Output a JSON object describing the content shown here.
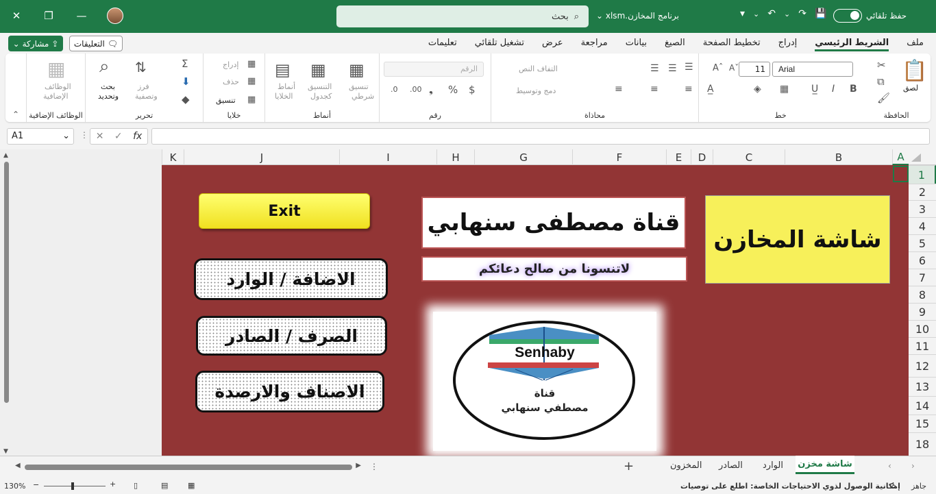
{
  "titlebar": {
    "search_placeholder": "بحث",
    "filename": "برنامج المخازن.xlsm",
    "autosave_label": "حفظ تلقائي"
  },
  "menu": {
    "share_label": "مشاركة",
    "comments_label": "التعليقات",
    "tabs": [
      "ملف",
      "الشريط الرئيسي",
      "إدراج",
      "تخطيط الصفحة",
      "الصيغ",
      "بيانات",
      "مراجعة",
      "عرض",
      "تشغيل تلقائي",
      "تعليمات"
    ]
  },
  "ribbon": {
    "clipboard": {
      "label": "الحافظة",
      "paste": "لصق"
    },
    "font": {
      "label": "خط",
      "name": "Arial",
      "size": "11"
    },
    "alignment": {
      "label": "محاذاة",
      "wrap": "التفاف النص",
      "merge": "دمج وتوسيط"
    },
    "number": {
      "label": "رقم",
      "format": "الرقم"
    },
    "styles": {
      "label": "أنماط",
      "conditional_1": "تنسيق",
      "conditional_2": "شرطي",
      "table_1": "التنسيق",
      "table_2": "كجدول",
      "cell_1": "أنماط",
      "cell_2": "الخلايا"
    },
    "cells": {
      "label": "خلايا",
      "insert": "إدراج",
      "delete": "حذف",
      "format": "تنسيق"
    },
    "editing": {
      "label": "تحرير",
      "sort_1": "فرز",
      "sort_2": "وتصفية",
      "find_1": "بحث",
      "find_2": "وتحديد"
    },
    "addins": {
      "label": "الوظائف الإضافية",
      "btn_1": "الوظائف",
      "btn_2": "الإضافية"
    }
  },
  "formula_bar": {
    "name_box": "A1",
    "fx": "fx",
    "formula": ""
  },
  "columns": [
    "K",
    "J",
    "I",
    "H",
    "G",
    "F",
    "E",
    "D",
    "C",
    "B",
    "A"
  ],
  "rows": [
    "1",
    "2",
    "3",
    "4",
    "5",
    "6",
    "7",
    "8",
    "9",
    "10",
    "11",
    "12",
    "13",
    "14",
    "15",
    "18"
  ],
  "sheet_content": {
    "title": "شاشة المخازن",
    "channel": "قناة مصطفى سنهابي",
    "prayer": "لاتنسونا من صالح دعائكم",
    "exit_label": "Exit",
    "btn_add": "الاضافة / الوارد",
    "btn_issue": "الصرف / الصادر",
    "btn_items": "الاصناف والارصدة",
    "logo_brand": "Senhaby",
    "logo_line1": "قناة",
    "logo_line2": "مصطفي سنهابي"
  },
  "sheet_tabs": {
    "active": "شاشة مخزن",
    "others": [
      "الوارد",
      "الصادر",
      "المخزون"
    ]
  },
  "status": {
    "ready": "جاهز",
    "accessibility": "إمكانية الوصول لذوي الاحتياجات الخاصة: اطلع على توصيات",
    "zoom": "130%"
  },
  "colors": {
    "brand": "#1f7a47",
    "sheet_bg": "#923535",
    "title_yellow": "#f7f05a"
  }
}
